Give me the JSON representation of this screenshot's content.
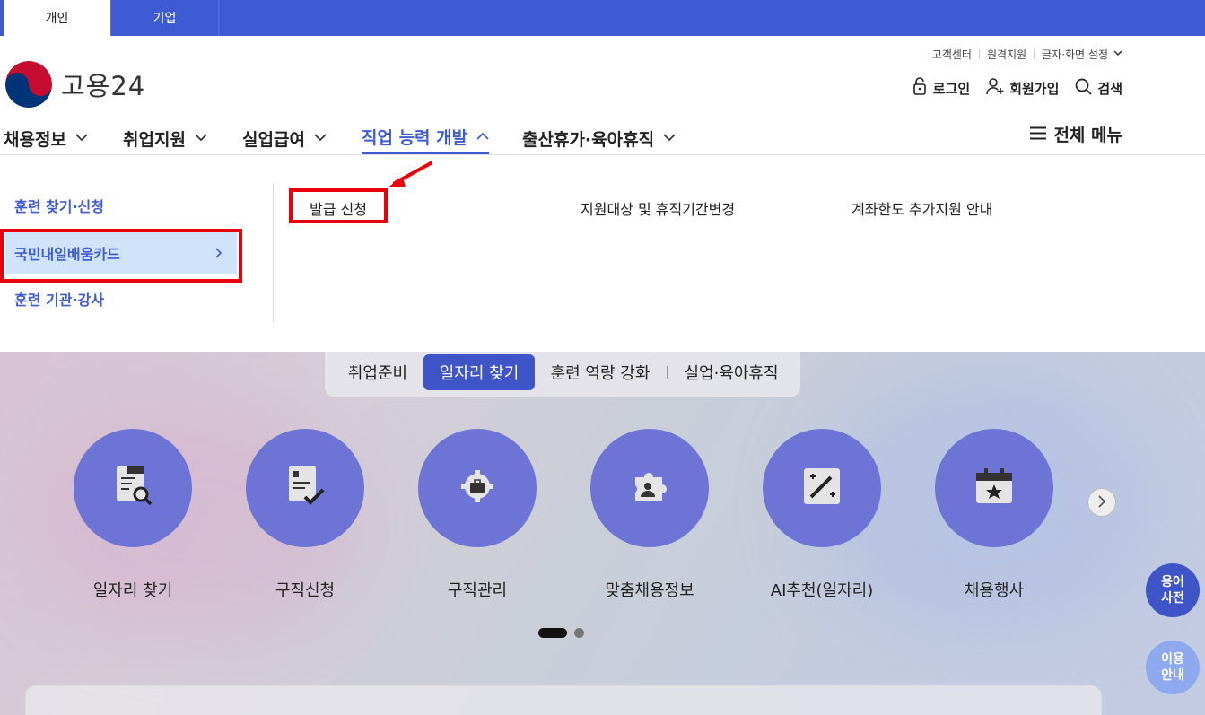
{
  "usertype": {
    "tabs": [
      "개인",
      "기업"
    ]
  },
  "header": {
    "logo_text": "고용24",
    "util_links": [
      "고객센터",
      "원격지원",
      "글자·화면 설정"
    ],
    "user_links": {
      "login": "로그인",
      "join": "회원가입",
      "search": "검색"
    }
  },
  "gnb": {
    "menus": [
      "채용정보",
      "취업지원",
      "실업급여",
      "직업 능력 개발",
      "출산휴가·육아휴직"
    ],
    "active_index": 3,
    "all_menu": "전체 메뉴"
  },
  "dropdown": {
    "submenus": [
      "훈련 찾기·신청",
      "국민내일배움카드",
      "훈련 기관·강사"
    ],
    "selected_index": 1,
    "items": [
      "발급 신청",
      "지원대상 및 휴직기간변경",
      "계좌한도 추가지원 안내"
    ]
  },
  "hero": {
    "tabs": [
      "취업준비",
      "일자리 찾기",
      "훈련 역량 강화",
      "실업·육아휴직"
    ],
    "active_tab": 1,
    "services": [
      {
        "label": "일자리 찾기",
        "icon": "document-search-icon"
      },
      {
        "label": "구직신청",
        "icon": "document-check-icon"
      },
      {
        "label": "구직관리",
        "icon": "gear-briefcase-icon"
      },
      {
        "label": "맞춤채용정보",
        "icon": "puzzle-person-icon"
      },
      {
        "label": "AI추천(일자리)",
        "icon": "magic-wand-icon"
      },
      {
        "label": "채용행사",
        "icon": "calendar-star-icon"
      }
    ],
    "carousel_pages": 2,
    "carousel_current": 1
  },
  "floating": {
    "dictionary": "용어\n사전",
    "guide": "이용\n안내"
  },
  "colors": {
    "brand": "#3f5bd4",
    "active_tab": "#3f55c7",
    "service_circle": "#6d74d6",
    "highlight": "#e8000b",
    "selected_bg": "#cfe3fb"
  }
}
